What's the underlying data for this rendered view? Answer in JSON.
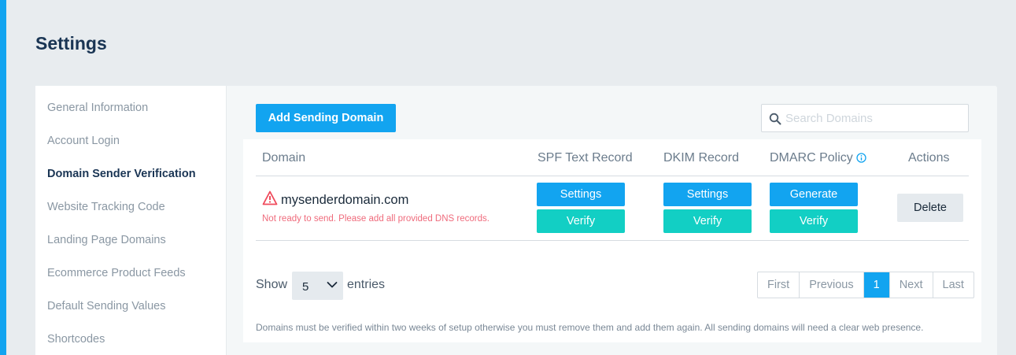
{
  "page": {
    "title": "Settings"
  },
  "sidebar": {
    "items": [
      {
        "label": "General Information",
        "active": false
      },
      {
        "label": "Account Login",
        "active": false
      },
      {
        "label": "Domain Sender Verification",
        "active": true
      },
      {
        "label": "Website Tracking Code",
        "active": false
      },
      {
        "label": "Landing Page Domains",
        "active": false
      },
      {
        "label": "Ecommerce Product Feeds",
        "active": false
      },
      {
        "label": "Default Sending Values",
        "active": false
      },
      {
        "label": "Shortcodes",
        "active": false
      }
    ]
  },
  "toolbar": {
    "add_label": "Add Sending Domain",
    "search_placeholder": "Search Domains",
    "search_value": ""
  },
  "table": {
    "headers": {
      "domain": "Domain",
      "spf": "SPF Text Record",
      "dkim": "DKIM Record",
      "dmarc": "DMARC Policy",
      "actions": "Actions"
    },
    "rows": [
      {
        "domain": "mysenderdomain.com",
        "status_message": "Not ready to send. Please add all provided DNS records.",
        "spf_settings": "Settings",
        "spf_verify": "Verify",
        "dkim_settings": "Settings",
        "dkim_verify": "Verify",
        "dmarc_generate": "Generate",
        "dmarc_verify": "Verify",
        "delete": "Delete"
      }
    ]
  },
  "footer": {
    "show_label": "Show",
    "entries_value": "5",
    "entries_label": "entries",
    "pagination": {
      "first": "First",
      "previous": "Previous",
      "current": "1",
      "next": "Next",
      "last": "Last"
    },
    "note": "Domains must be verified within two weeks of setup otherwise you must remove them and add them again. All sending domains will need a clear web presence."
  },
  "colors": {
    "accent": "#12a4f0",
    "teal": "#12cfc4",
    "warning": "#ef4b5c",
    "title": "#1a3554"
  },
  "icons": {
    "search": "search-icon",
    "info": "info-icon",
    "warning": "warning-triangle-icon",
    "chevron": "chevron-down-icon"
  }
}
